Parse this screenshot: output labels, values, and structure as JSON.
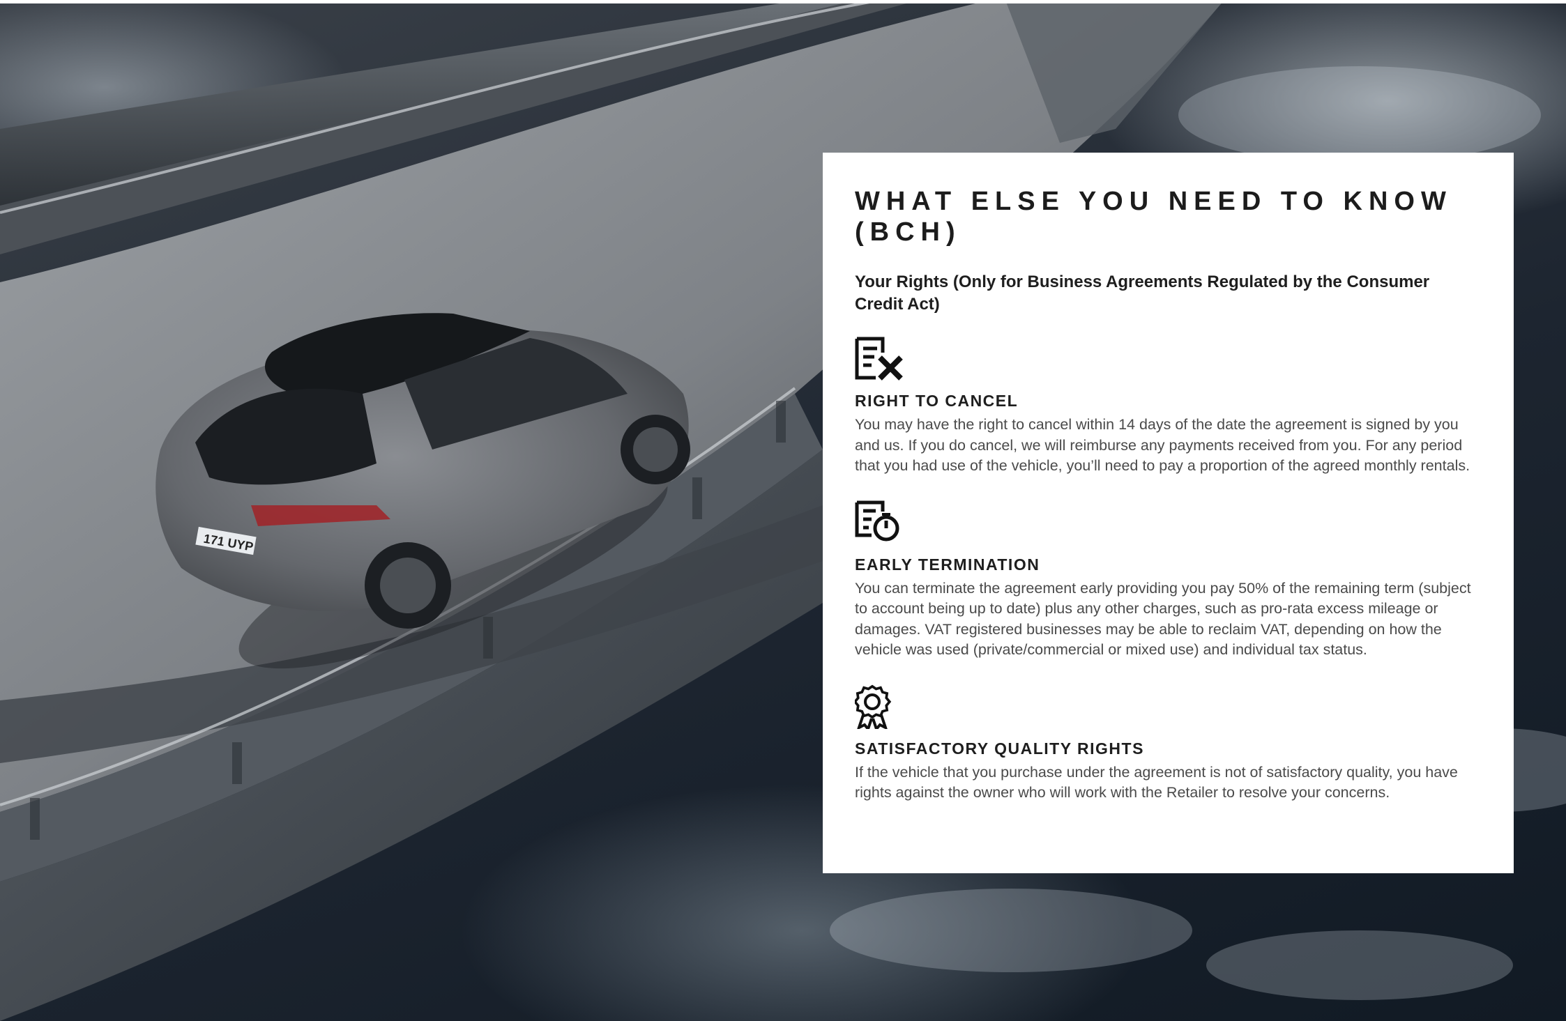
{
  "heading": {
    "title": "WHAT ELSE YOU NEED TO KNOW (BCH)",
    "subtitle": "Your Rights (Only for Business Agreements Regulated by the Consumer Credit Act)"
  },
  "sections": [
    {
      "icon": "document-cancel-icon",
      "title": "RIGHT TO CANCEL",
      "body": "You may have the right to cancel within 14 days of the date the agreement is signed by you and us. If you do cancel, we will reimburse any payments received from you. For any period that you had use of the vehicle, you’ll need to pay a proportion of the agreed monthly rentals."
    },
    {
      "icon": "document-timer-icon",
      "title": "EARLY TERMINATION",
      "body": "You can terminate the agreement early providing you pay 50% of the remaining term (subject to account being up to date) plus any other charges, such as pro-rata excess mileage or damages. VAT registered businesses may be able to reclaim VAT, depending on how the vehicle was used (private/commercial or mixed use) and individual tax status."
    },
    {
      "icon": "award-ribbon-icon",
      "title": "SATISFACTORY QUALITY RIGHTS",
      "body": "If the vehicle that you purchase under the agreement is not of satisfactory quality, you have rights against the owner who will work with the Retailer to resolve your concerns."
    }
  ],
  "photo": {
    "license_plate": "171 UYP",
    "subject": "grey electric SUV driving on a curved coastal bridge"
  },
  "colors": {
    "card_background": "#ffffff",
    "heading_text": "#1c1c1c",
    "body_text": "#4a4a4a",
    "car_body": "#6b6e73",
    "bridge_road": "#8f9397"
  }
}
